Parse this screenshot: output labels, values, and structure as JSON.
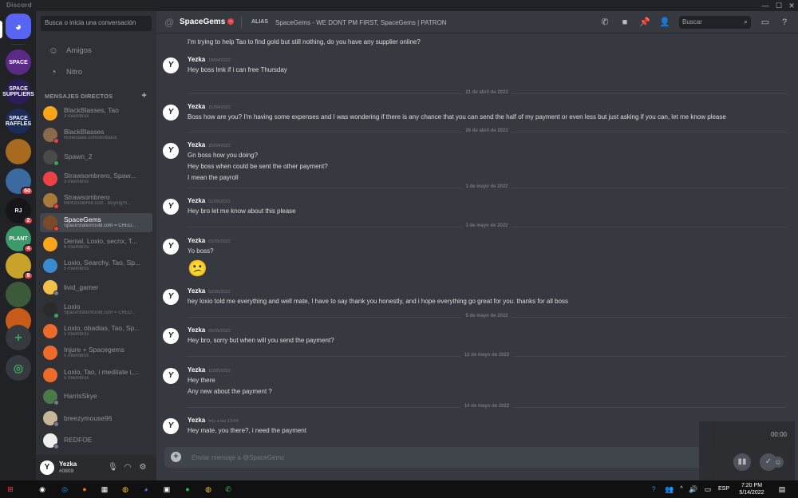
{
  "app": {
    "title": "Discord"
  },
  "servers": [
    {
      "label": "SPACE",
      "color": "#5b2a86",
      "badge": ""
    },
    {
      "label": "SPACE SUPPLIERS",
      "color": "#2b1c5a",
      "badge": ""
    },
    {
      "label": "SPACE RAFFLES",
      "color": "#1c2c5a",
      "badge": ""
    },
    {
      "label": "",
      "color": "#a86a1f",
      "badge": ""
    },
    {
      "label": "",
      "color": "#3a6aa0",
      "badge": "60"
    },
    {
      "label": "RJ",
      "color": "#16161a",
      "badge": "2"
    },
    {
      "label": "PLANT",
      "color": "#3a9a6a",
      "badge": "4"
    },
    {
      "label": "",
      "color": "#c8a22a",
      "badge": "9"
    },
    {
      "label": "",
      "color": "#3a5a3a",
      "badge": ""
    },
    {
      "label": "",
      "color": "#c85a1a",
      "badge": ""
    }
  ],
  "sidebar": {
    "search_placeholder": "Busca o inicia una conversación",
    "friends": "Amigos",
    "nitro": "Nitro",
    "dm_header": "MENSAJES DIRECTOS",
    "dms": [
      {
        "name": "BlackBlasses, Tao",
        "sub": "3 miembros",
        "color": "#faa61a",
        "status": ""
      },
      {
        "name": "BlackBlasses",
        "sub": "Runestake.com/do/Black",
        "color": "#8a6a4a",
        "status": "#ed4245"
      },
      {
        "name": "Spawn_2",
        "sub": "",
        "color": "#4a4a4a",
        "status": "#3ba55d"
      },
      {
        "name": "Strawsombrero, Spaw...",
        "sub": "3 miembros",
        "color": "#ed4245",
        "status": ""
      },
      {
        "name": "Strawsombrero",
        "sub": "MMOGoldHut.com - Buying/S...",
        "color": "#a87a3a",
        "status": "#ed4245"
      },
      {
        "name": "SpaceGems",
        "sub": "SpaceStationGold.com = CRED...",
        "color": "#7a4a2a",
        "status": "#ed4245"
      },
      {
        "name": "Denial, Loxio, secnx, T...",
        "sub": "6 miembros",
        "color": "#faa61a",
        "status": ""
      },
      {
        "name": "Loxio, Searchy, Tao, Sp...",
        "sub": "5 miembros",
        "color": "#3a8ad0",
        "status": ""
      },
      {
        "name": "livid_gamer",
        "sub": "",
        "color": "#f2c14a",
        "status": "#747f8d"
      },
      {
        "name": "Loxio",
        "sub": "SpaceStationGold.com = CRED...",
        "color": "#2a2a2a",
        "status": "#3ba55d"
      },
      {
        "name": "Loxio, obadias, Tao, Sp...",
        "sub": "5 miembros",
        "color": "#ec6a2a",
        "status": ""
      },
      {
        "name": "Injure + Spacegems",
        "sub": "5 miembros",
        "color": "#ec6a2a",
        "status": ""
      },
      {
        "name": "Loxio, Tao, i meditate i,...",
        "sub": "5 miembros",
        "color": "#ec6a2a",
        "status": ""
      },
      {
        "name": "HarrisSkye",
        "sub": "",
        "color": "#4a7a4a",
        "status": "#747f8d"
      },
      {
        "name": "breezymouse96",
        "sub": "",
        "color": "#c8b89a",
        "status": "#747f8d"
      },
      {
        "name": "REDFOE",
        "sub": "",
        "color": "#eeeeee",
        "status": "#747f8d"
      }
    ]
  },
  "user": {
    "name": "Yezka",
    "tag": "#0809"
  },
  "header": {
    "at": "@",
    "title": "SpaceGems",
    "alias_label": "ALIAS",
    "alias_value": "SpaceGems - WE DONT PM FIRST, SpaceGems | PATRON",
    "search_placeholder": "Buscar"
  },
  "messages": {
    "top_line": "I'm trying to help Tao to find gold but still nothing, do you have any supplier online?",
    "groups": [
      {
        "author": "Yezka",
        "ts": "18/04/2022",
        "lines": [
          "Hey boss lmk if i can free Thursday"
        ]
      },
      {
        "divider": "21 de abril de 2022"
      },
      {
        "author": "Yezka",
        "ts": "21/04/2022",
        "lines": [
          "Boss how are you? I'm having some expenses and I was wondering if there is any chance that you can send the half of my payment or even less but just asking if you can, let me know please"
        ]
      },
      {
        "divider": "26 de abril de 2022"
      },
      {
        "author": "Yezka",
        "ts": "26/04/2022",
        "lines": [
          "Gn boss how you doing?",
          "Hey boss when could be sent the other payment?",
          "I mean the payroll"
        ]
      },
      {
        "divider": "1 de mayo de 2022"
      },
      {
        "author": "Yezka",
        "ts": "01/05/2022",
        "lines": [
          "Hey bro let me know about this please"
        ]
      },
      {
        "divider": "3 de mayo de 2022"
      },
      {
        "author": "Yezka",
        "ts": "03/05/2022",
        "lines": [
          "Yo boss?"
        ],
        "emoji": "😕"
      },
      {
        "author": "Yezka",
        "ts": "03/05/2022",
        "lines": [
          "hey loxio told me everything and well mate, I have to say thank you honestly, and i hope everything go great for you. thanks for all boss"
        ]
      },
      {
        "divider": "5 de mayo de 2022"
      },
      {
        "author": "Yezka",
        "ts": "05/05/2022",
        "lines": [
          "Hey bro, sorry but when will you send the payment?"
        ]
      },
      {
        "divider": "12 de mayo de 2022"
      },
      {
        "author": "Yezka",
        "ts": "12/05/2022",
        "lines": [
          "Hey there",
          "Any new about the payment ?"
        ]
      },
      {
        "divider": "14 de mayo de 2022"
      },
      {
        "author": "Yezka",
        "ts": "hoy a las 13:54",
        "lines": [
          "Hey mate, you there?, i need the payment"
        ]
      }
    ]
  },
  "composer": {
    "placeholder": "Enviar mensaje a @SpaceGems"
  },
  "recording": {
    "time": "00:00"
  },
  "taskbar": {
    "lang": "ESP",
    "time": "7:20 PM",
    "date": "5/14/2022"
  }
}
